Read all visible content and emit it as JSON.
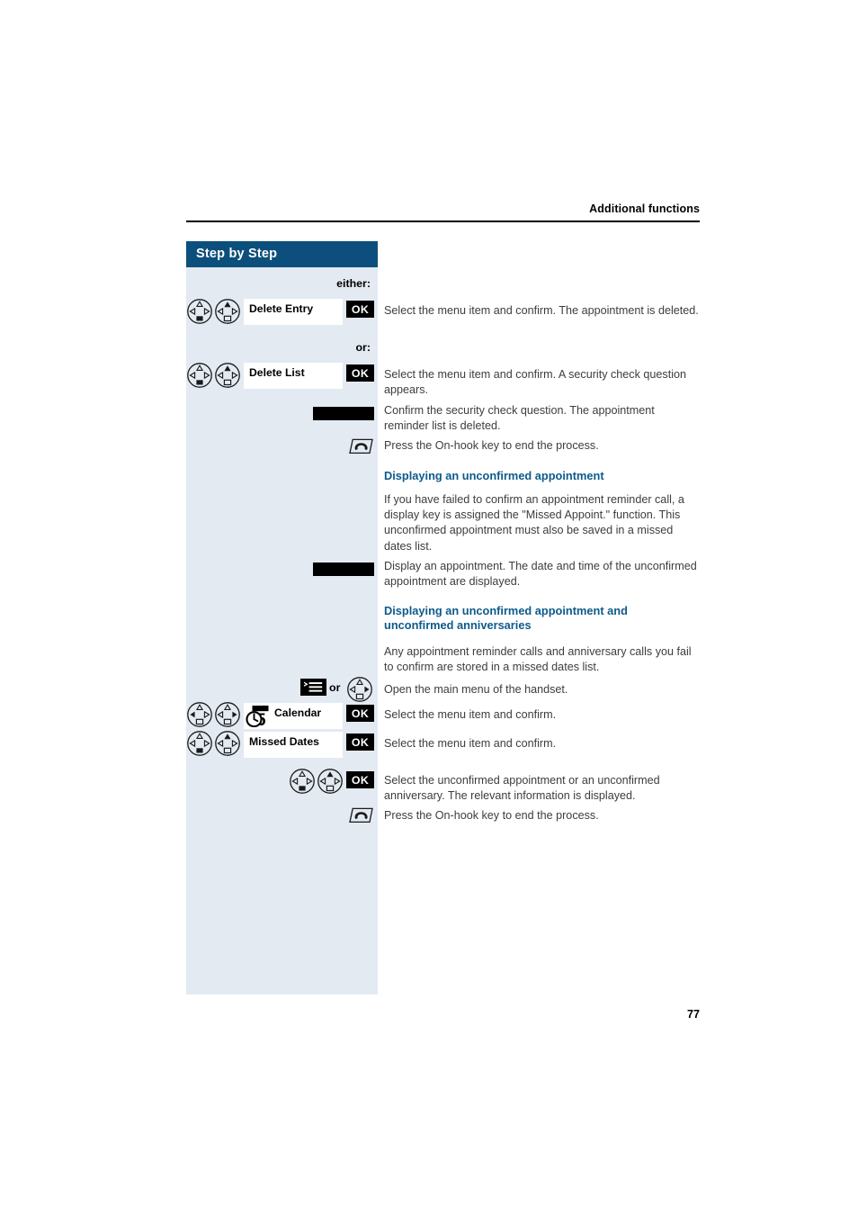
{
  "document": {
    "running_head": "Additional functions",
    "page_number": "77"
  },
  "sidebar": {
    "title": "Step by Step",
    "accent_color": "#0d4f7c",
    "background_color": "#e3eaf2"
  },
  "steps": [
    {
      "marker": "either:",
      "menu_label": "Delete Entry",
      "confirm_label": "OK",
      "text": "Select the menu item and confirm. The appointment is deleted."
    },
    {
      "marker": "or:",
      "menu_label": "Delete List",
      "confirm_label": "OK",
      "text": "Select the menu item and confirm. A security check question appears."
    },
    {
      "text": "Confirm the security check question. The appointment reminder list is deleted."
    },
    {
      "text": "Press the On-hook key to end the process."
    }
  ],
  "sections": [
    {
      "heading": "Displaying an unconfirmed appointment",
      "paragraphs": [
        "If you have failed to confirm an appointment reminder call, a display key is assigned the \"Missed Appoint.\" function. This unconfirmed appointment must also be saved in a missed dates list.",
        "Display an appointment. The date and time of the unconfirmed appointment are displayed."
      ]
    },
    {
      "heading_line1": "Displaying an unconfirmed appointment and",
      "heading_line2": "unconfirmed anniversaries",
      "paragraphs": [
        "Any appointment reminder calls and anniversary calls you fail to confirm are stored in a missed dates list.",
        "Open the main menu of the handset.",
        "Select the menu item and confirm.",
        "Select the menu item and confirm.",
        "Select the unconfirmed appointment or an unconfirmed anniversary. The relevant information is displayed.",
        "Press the On-hook key to end the process."
      ],
      "or_label": "or",
      "menu_items": [
        {
          "label": "Calendar",
          "confirm_label": "OK"
        },
        {
          "label": "Missed Dates",
          "confirm_label": "OK"
        }
      ],
      "final_confirm_label": "OK"
    }
  ],
  "icons": {
    "nav_key": "navigation-key-icon",
    "menu_key": "menu-key-icon",
    "calendar": "calendar-icon",
    "on_hook": "on-hook-key-icon",
    "blank_display_key": "display-key-icon"
  }
}
